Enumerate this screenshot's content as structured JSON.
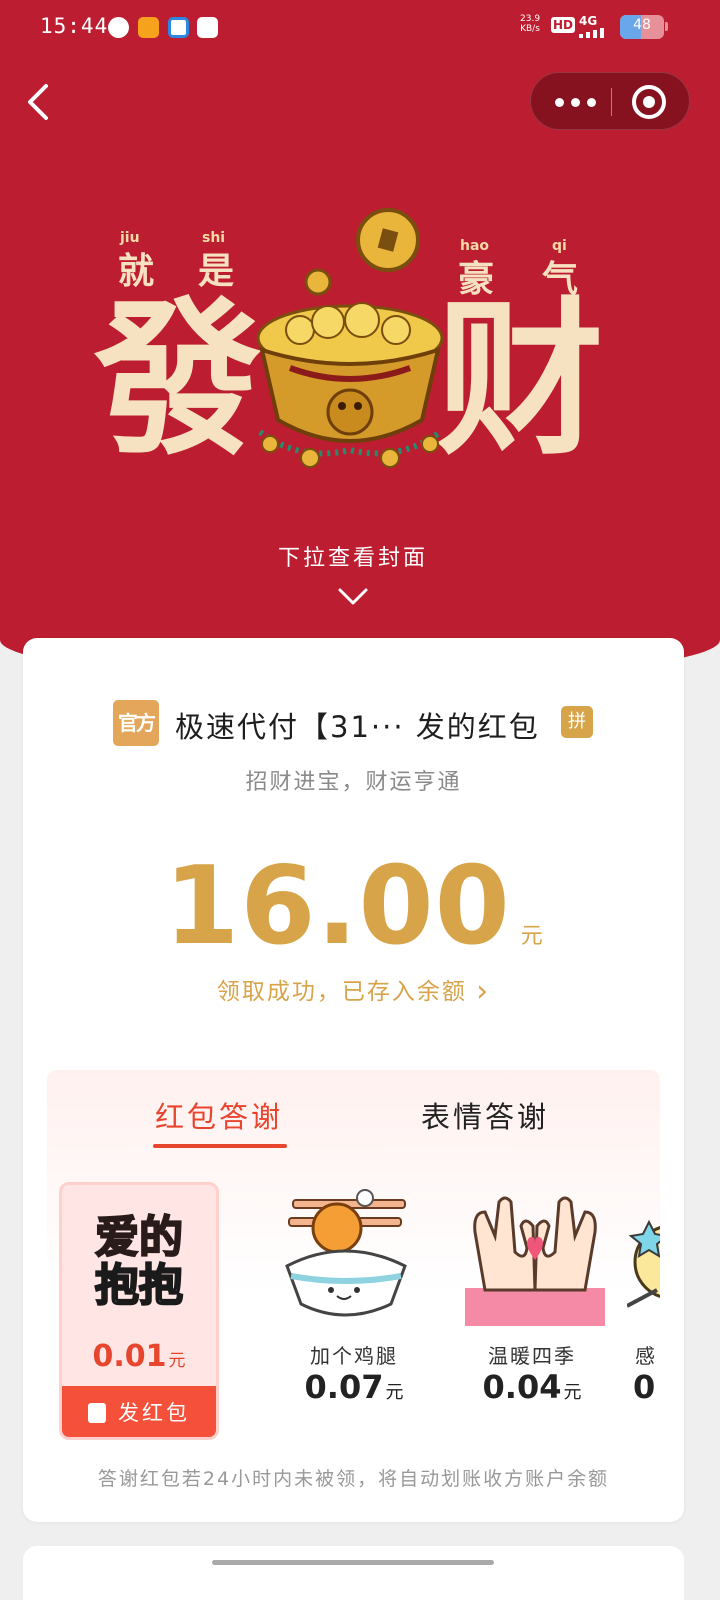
{
  "status_bar": {
    "time": "15:44",
    "net_speed": "23.9",
    "net_unit": "KB/s",
    "hd": "HD",
    "network": "4G",
    "battery": "48",
    "battery_level": 0.48
  },
  "nav": {
    "back_icon": "chevron-left-icon",
    "more_icon": "more-dots-icon",
    "close_icon": "target-close-icon"
  },
  "cover": {
    "pinyin_jiu": "jiu",
    "pinyin_shi": "shi",
    "pinyin_hao": "hao",
    "pinyin_qi": "qi",
    "char_jiu": "就",
    "char_shi": "是",
    "char_hao": "豪",
    "char_qi": "气",
    "big_fa": "發",
    "big_cai": "财",
    "pull_hint": "下拉查看封面"
  },
  "packet": {
    "official_badge": "官方",
    "sender_line": "极速代付【31··· 发的红包",
    "pin_badge": "拼",
    "blessing": "招财进宝，财运亨通",
    "amount": "16.00",
    "unit": "元",
    "claimed_text": "领取成功，已存入余额",
    "claimed_arrow": "›"
  },
  "thanks": {
    "tabs": [
      {
        "label": "红包答谢",
        "active": true
      },
      {
        "label": "表情答谢",
        "active": false
      }
    ],
    "items": [
      {
        "line1": "爱的",
        "line2": "抱抱",
        "price": "0.01",
        "unit": "元",
        "selected": true
      },
      {
        "name": "加个鸡腿",
        "price": "0.07",
        "unit": "元"
      },
      {
        "name": "温暖四季",
        "price": "0.04",
        "unit": "元"
      },
      {
        "name": "感",
        "price": "0",
        "unit": ""
      }
    ],
    "send_button": "发红包",
    "footnote": "答谢红包若24小时内未被领，将自动划账收方账户余额"
  },
  "colors": {
    "header_red": "#bd1d30",
    "gold": "#d7a44a",
    "accent_red": "#e8452f",
    "send_button": "#f4503a"
  }
}
